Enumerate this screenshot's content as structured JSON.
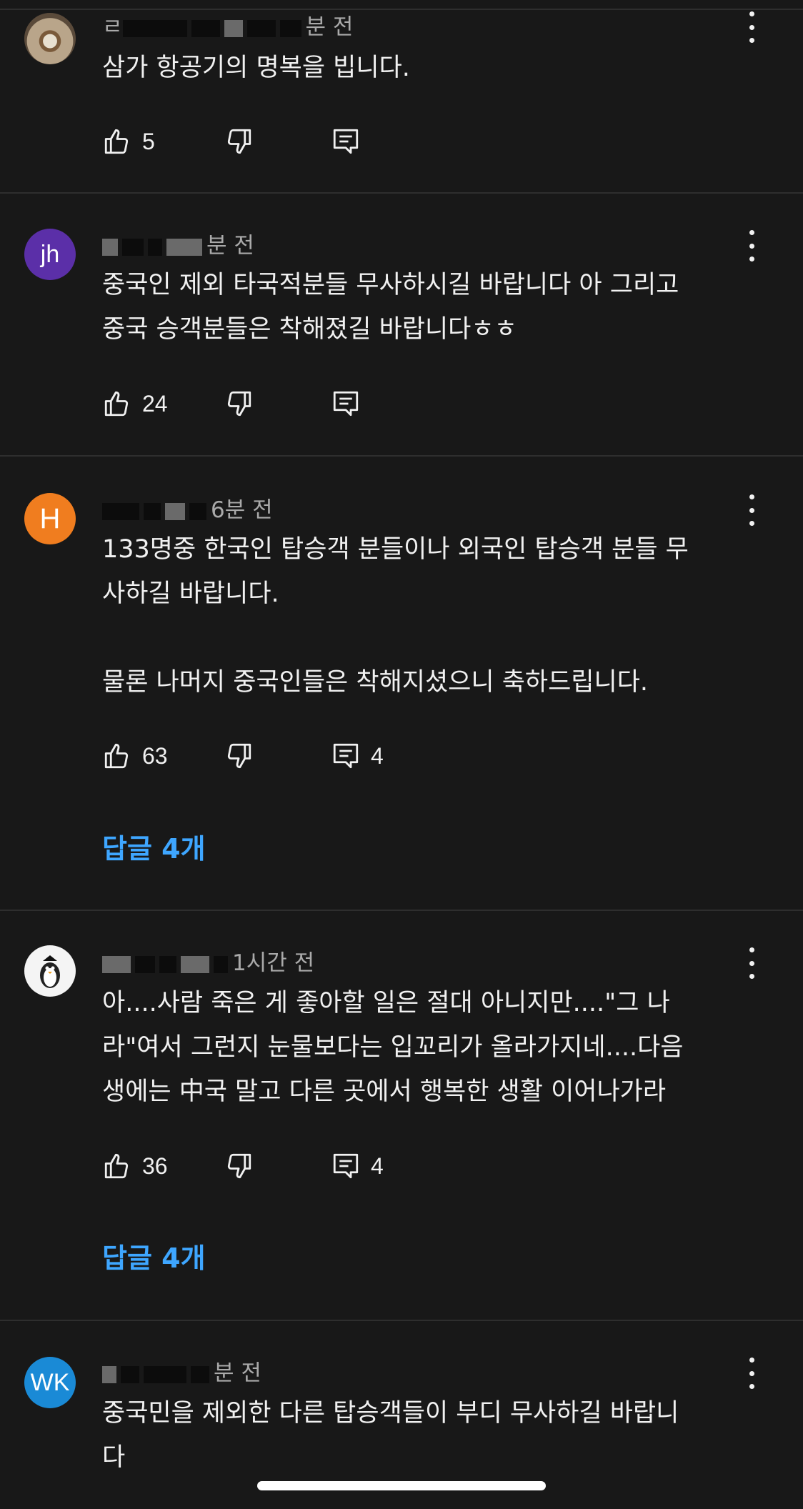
{
  "comments": [
    {
      "meta": "분 전",
      "meta_prefix": "ㄹ",
      "text": "삼가 항공기의 명복을 빕니다.",
      "likes": "5",
      "reply_count": ""
    },
    {
      "meta": "분 전",
      "meta_prefix": "",
      "avatar_text": "jh",
      "text": "중국인 제외 타국적분들 무사하시길 바랍니다 아 그리고\n중국 승객분들은 착해졌길 바랍니다ㅎㅎ",
      "likes": "24",
      "reply_count": ""
    },
    {
      "meta": "6분 전",
      "avatar_text": "H",
      "text": "133명중 한국인 탑승객 분들이나 외국인 탑승객 분들 무\n사하길 바랍니다.\n\n물론 나머지 중국인들은 착해지셨으니 축하드립니다.",
      "likes": "63",
      "reply_count": "4",
      "replies_link": "답글 4개"
    },
    {
      "meta": "1시간 전",
      "text": "아....사람 죽은 게 좋아할 일은 절대 아니지만....\"그 나\n라\"여서 그런지 눈물보다는 입꼬리가 올라가지네....다음\n생에는 中국 말고 다른 곳에서 행복한 생활 이어나가라",
      "likes": "36",
      "reply_count": "4",
      "replies_link": "답글 4개"
    },
    {
      "meta": "분 전",
      "avatar_text": "WK",
      "text": "중국민을 제외한 다른 탑승객들이 부디 무사하길 바랍니\n다",
      "likes": "",
      "reply_count": ""
    }
  ],
  "colors": {
    "background": "#181818",
    "link": "#3ea6ff",
    "meta": "#aaaaaa"
  },
  "icons": [
    "like-icon",
    "dislike-icon",
    "reply-icon",
    "more-vert-icon"
  ]
}
